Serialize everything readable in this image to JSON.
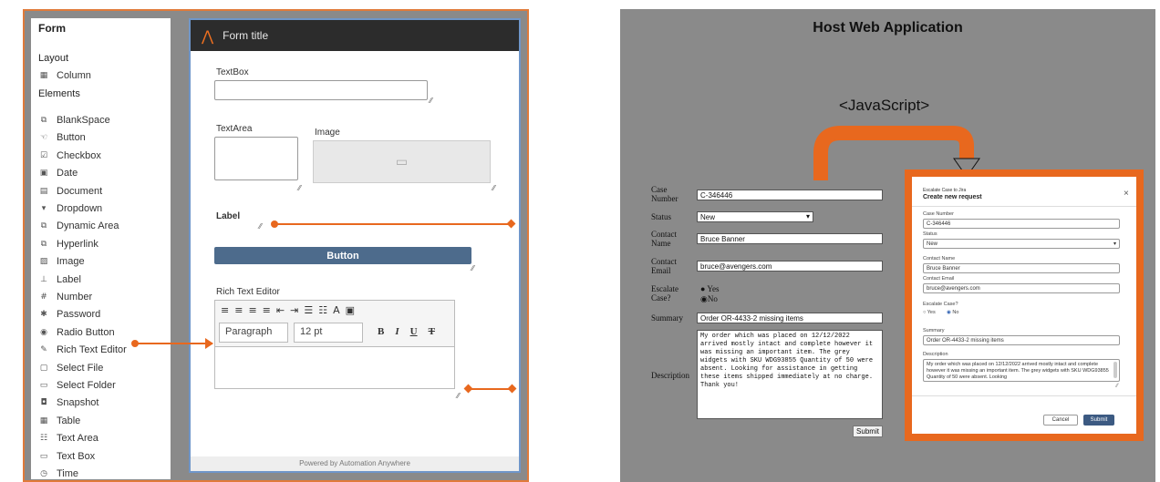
{
  "left": {
    "sidebar": {
      "title": "Form",
      "section_layout": "Layout",
      "section_elements": "Elements",
      "layout_items": [
        {
          "label": "Column",
          "icon": "column-icon"
        }
      ],
      "element_items": [
        {
          "label": "BlankSpace",
          "icon": "blankspace-icon"
        },
        {
          "label": "Button",
          "icon": "button-icon"
        },
        {
          "label": "Checkbox",
          "icon": "checkbox-icon"
        },
        {
          "label": "Date",
          "icon": "date-icon"
        },
        {
          "label": "Document",
          "icon": "document-icon"
        },
        {
          "label": "Dropdown",
          "icon": "dropdown-icon"
        },
        {
          "label": "Dynamic Area",
          "icon": "dynamic-area-icon"
        },
        {
          "label": "Hyperlink",
          "icon": "hyperlink-icon"
        },
        {
          "label": "Image",
          "icon": "image-icon"
        },
        {
          "label": "Label",
          "icon": "label-icon"
        },
        {
          "label": "Number",
          "icon": "number-icon"
        },
        {
          "label": "Password",
          "icon": "password-icon"
        },
        {
          "label": "Radio Button",
          "icon": "radio-button-icon"
        },
        {
          "label": "Rich Text Editor",
          "icon": "rich-text-editor-icon"
        },
        {
          "label": "Select File",
          "icon": "select-file-icon"
        },
        {
          "label": "Select Folder",
          "icon": "select-folder-icon"
        },
        {
          "label": "Snapshot",
          "icon": "snapshot-icon"
        },
        {
          "label": "Table",
          "icon": "table-icon"
        },
        {
          "label": "Text Area",
          "icon": "text-area-icon"
        },
        {
          "label": "Text Box",
          "icon": "text-box-icon"
        },
        {
          "label": "Time",
          "icon": "time-icon"
        }
      ]
    },
    "form": {
      "title": "Form title",
      "textbox_label": "TextBox",
      "textarea_label": "TextArea",
      "image_label": "Image",
      "label_label": "Label",
      "button_label": "Button",
      "rte_label": "Rich Text Editor",
      "rte_paragraph": "Paragraph",
      "rte_size": "12 pt",
      "footer": "Powered by Automation Anywhere"
    },
    "accent": "#e8681e"
  },
  "right": {
    "title": "Host Web Application",
    "js_label": "<JavaScript>",
    "legacy": {
      "case_number_label": "Case Number",
      "case_number": "C-346446",
      "status_label": "Status",
      "status": "New",
      "contact_name_label": "Contact Name",
      "contact_name": "Bruce Banner",
      "contact_email_label": "Contact Email",
      "contact_email": "bruce@avengers.com",
      "escalate_label": "Escalate Case?",
      "yes": "Yes",
      "no": "No",
      "summary_label": "Summary",
      "summary": "Order OR-4433-2 missing items",
      "description_label": "Description",
      "description": "My order which was placed on 12/12/2022 arrived mostly intact and complete however it was missing an important item. The grey widgets with SKU WDG93855 Quantity of 50 were absent. Looking for assistance in getting these items shipped immediately at no charge. Thank you!",
      "submit": "Submit"
    },
    "modal": {
      "breadcrumb": "Escalate Case to Jira",
      "title": "Create new request",
      "case_number_label": "Case Number",
      "case_number": "C-346446",
      "status_label": "Status",
      "status": "New",
      "contact_name_label": "Contact Name",
      "contact_name": "Bruce Banner",
      "contact_email_label": "Contact Email",
      "contact_email": "bruce@avengers.com",
      "escalate_label": "Escalate Case?",
      "yes": "Yes",
      "no": "No",
      "summary_label": "Summary",
      "summary": "Order OR-4433-2 missing items",
      "description_label": "Description",
      "description": "My order which was placed on 12/12/2022 arrived mostly intact and complete however it was missing an important item. The grey widgets with SKU WDG93855 Quantity of 50 were absent. Looking",
      "cancel": "Cancel",
      "submit": "Submit"
    }
  }
}
